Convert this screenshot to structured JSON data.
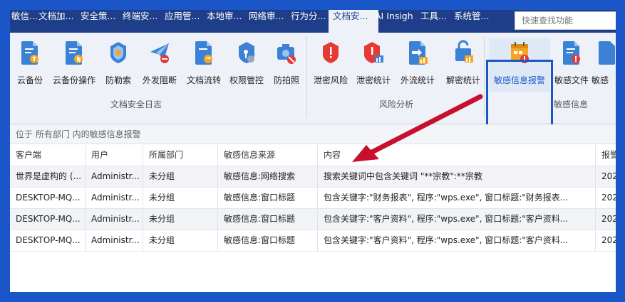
{
  "menu": {
    "items": [
      {
        "label": "敏信..."
      },
      {
        "label": "文档加..."
      },
      {
        "label": "安全策..."
      },
      {
        "label": "终端安..."
      },
      {
        "label": "应用管..."
      },
      {
        "label": "本地审..."
      },
      {
        "label": "网络审..."
      },
      {
        "label": "行为分..."
      },
      {
        "label": "文档安..."
      },
      {
        "label": "AI Insigh"
      },
      {
        "label": "工具..."
      },
      {
        "label": "系统管..."
      }
    ],
    "active_index": 8,
    "search_placeholder": "快速查找功能"
  },
  "ribbon": {
    "groups": [
      {
        "label": "文档安全日志"
      },
      {
        "label": "风险分析"
      },
      {
        "label": "敏感信息"
      }
    ],
    "tools": [
      {
        "label": "云备份",
        "icon": "cloud-backup-icon"
      },
      {
        "label": "云备份操作",
        "icon": "cloud-backup-operation-icon"
      },
      {
        "label": "防勒索",
        "icon": "anti-ransomware-icon"
      },
      {
        "label": "外发阻断",
        "icon": "send-block-icon"
      },
      {
        "label": "文档流转",
        "icon": "document-flow-icon"
      },
      {
        "label": "权限管控",
        "icon": "permission-control-icon"
      },
      {
        "label": "防拍照",
        "icon": "anti-photo-icon"
      },
      {
        "label": "泄密风险",
        "icon": "leak-risk-icon"
      },
      {
        "label": "泄密统计",
        "icon": "leak-statistics-icon"
      },
      {
        "label": "外流统计",
        "icon": "outflow-statistics-icon"
      },
      {
        "label": "解密统计",
        "icon": "decrypt-statistics-icon"
      },
      {
        "label": "敏感信息报警",
        "icon": "sensitive-alarm-icon"
      },
      {
        "label": "敏感文件",
        "icon": "sensitive-file-icon"
      },
      {
        "label": "敏感",
        "icon": "sensitive-icon"
      }
    ],
    "selected_tool": "敏感信息报警"
  },
  "pathbar": {
    "text": "位于 所有部门 内的敏感信息报警"
  },
  "table": {
    "columns": [
      "客户端",
      "用户",
      "所属部门",
      "敏感信息来源",
      "内容",
      "报警"
    ],
    "rows": [
      [
        "世界是虚构的 (...",
        "Administr...",
        "未分组",
        "敏感信息:网络搜索",
        "搜索关键词中包含关键词 \"**宗教\":**宗教",
        "202"
      ],
      [
        "DESKTOP-MQ...",
        "Administr...",
        "未分组",
        "敏感信息:窗口标题",
        "包含关键字:\"财务报表\", 程序:\"wps.exe\", 窗口标题:\"财务报表...",
        "202"
      ],
      [
        "DESKTOP-MQ...",
        "Administr...",
        "未分组",
        "敏感信息:窗口标题",
        "包含关键字:\"客户资料\", 程序:\"wps.exe\", 窗口标题:\"客户资料...",
        "202"
      ],
      [
        "DESKTOP-MQ...",
        "Administr...",
        "未分组",
        "敏感信息:窗口标题",
        "包含关键字:\"客户资料\", 程序:\"wps.exe\", 窗口标题:\"客户资料...",
        "202"
      ]
    ]
  },
  "colors": {
    "border_blue": "#1a56c8",
    "menubar": "#1f3e8a",
    "arrow_red": "#c8102e",
    "icon_blue": "#3b82d6",
    "icon_red": "#e53935"
  }
}
